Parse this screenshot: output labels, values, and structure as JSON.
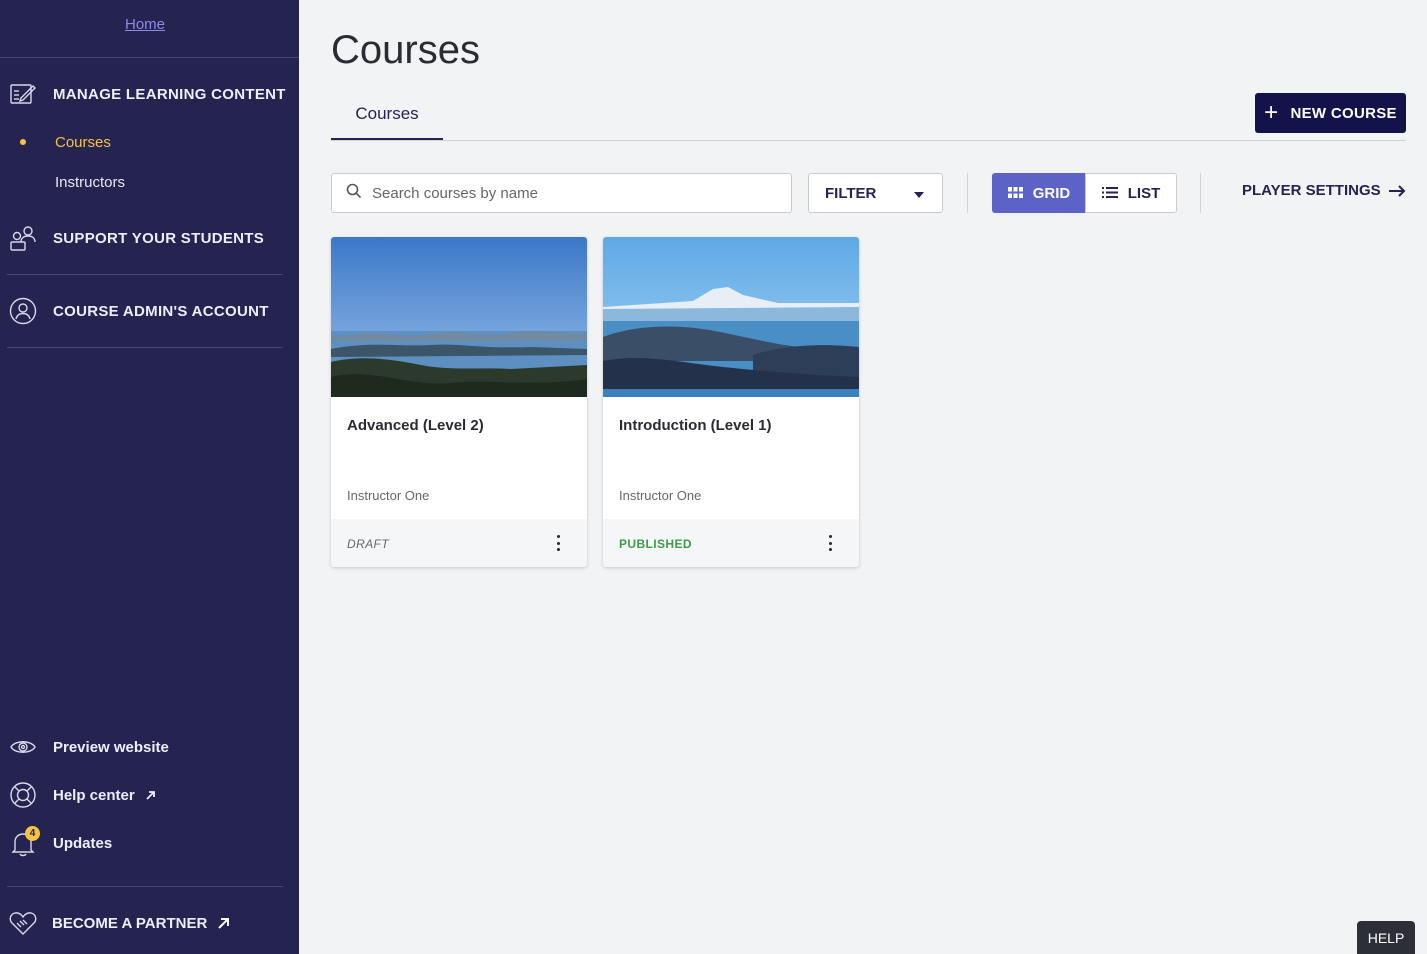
{
  "sidebar": {
    "home_link": "Home",
    "sections": [
      {
        "label": "MANAGE LEARNING CONTENT",
        "icon": "edit-list-icon"
      },
      {
        "label": "SUPPORT YOUR STUDENTS",
        "icon": "students-icon"
      },
      {
        "label": "COURSE ADMIN'S ACCOUNT",
        "icon": "account-icon"
      }
    ],
    "sub_items": [
      {
        "label": "Courses",
        "active": true
      },
      {
        "label": "Instructors",
        "active": false
      }
    ],
    "bottom_items": [
      {
        "label": "Preview website",
        "icon": "eye-icon"
      },
      {
        "label": "Help center",
        "icon": "lifebuoy-icon"
      },
      {
        "label": "Updates",
        "icon": "bell-icon",
        "badge": "4"
      }
    ],
    "partner": "BECOME A PARTNER"
  },
  "header": {
    "title": "Courses",
    "tab": "Courses",
    "new_course_label": "NEW COURSE"
  },
  "toolbar": {
    "search_placeholder": "Search courses by name",
    "filter_label": "FILTER",
    "grid_label": "GRID",
    "list_label": "LIST",
    "player_settings_label": "PLAYER SETTINGS"
  },
  "courses": [
    {
      "title": "Advanced (Level 2)",
      "instructor": "Instructor One",
      "status": "DRAFT"
    },
    {
      "title": "Introduction (Level 1)",
      "instructor": "Instructor One",
      "status": "PUBLISHED"
    }
  ],
  "help_button": "HELP",
  "colors": {
    "sidebar_bg": "#25234f",
    "accent_active": "#f6c342",
    "primary_button": "#14124a",
    "grid_active": "#5c62c6",
    "published": "#3f9b4a"
  }
}
